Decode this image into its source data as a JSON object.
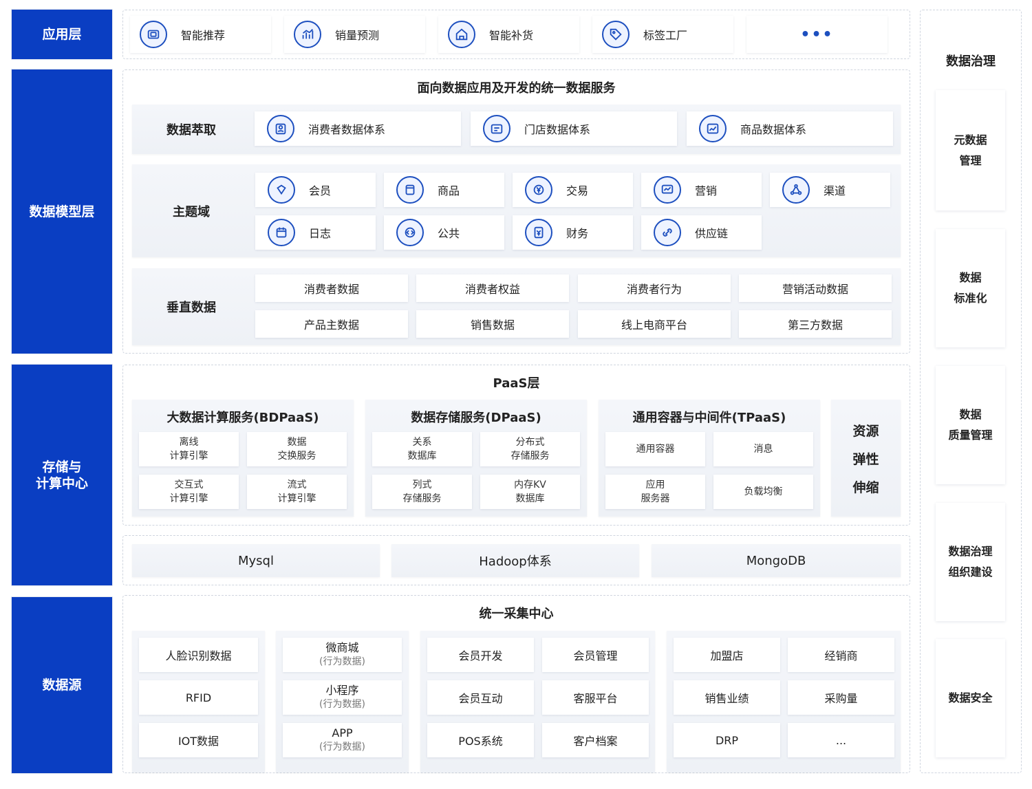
{
  "layers": {
    "app": "应用层",
    "model": "数据模型层",
    "storage": "存储与\n计算中心",
    "source": "数据源"
  },
  "app_layer": {
    "items": [
      {
        "label": "智能推荐",
        "icon": "recommend-icon"
      },
      {
        "label": "销量预测",
        "icon": "chart-icon"
      },
      {
        "label": "智能补货",
        "icon": "home-icon"
      },
      {
        "label": "标签工厂",
        "icon": "tag-icon"
      }
    ],
    "more": "•••"
  },
  "model_layer": {
    "title": "面向数据应用及开发的统一数据服务",
    "extract": {
      "label": "数据萃取",
      "items": [
        {
          "label": "消费者数据体系",
          "icon": "consumer-icon"
        },
        {
          "label": "门店数据体系",
          "icon": "store-icon"
        },
        {
          "label": "商品数据体系",
          "icon": "product-chart-icon"
        }
      ]
    },
    "subject": {
      "label": "主题域",
      "items": [
        {
          "label": "会员",
          "icon": "member-icon"
        },
        {
          "label": "商品",
          "icon": "goods-icon"
        },
        {
          "label": "交易",
          "icon": "yen-icon"
        },
        {
          "label": "营销",
          "icon": "marketing-icon"
        },
        {
          "label": "渠道",
          "icon": "channel-icon"
        },
        {
          "label": "日志",
          "icon": "log-icon"
        },
        {
          "label": "公共",
          "icon": "code-icon"
        },
        {
          "label": "财务",
          "icon": "finance-icon"
        },
        {
          "label": "供应链",
          "icon": "link-icon"
        }
      ]
    },
    "vertical": {
      "label": "垂直数据",
      "items": [
        "消费者数据",
        "消费者权益",
        "消费者行为",
        "营销活动数据",
        "产品主数据",
        "销售数据",
        "线上电商平台",
        "第三方数据"
      ]
    }
  },
  "paas_layer": {
    "title": "PaaS层",
    "groups": [
      {
        "title": "大数据计算服务(BDPaaS)",
        "items": [
          [
            "离线",
            "计算引擎"
          ],
          [
            "数据",
            "交换服务"
          ],
          [
            "交互式",
            "计算引擎"
          ],
          [
            "流式",
            "计算引擎"
          ]
        ]
      },
      {
        "title": "数据存储服务(DPaaS)",
        "items": [
          [
            "关系",
            "数据库"
          ],
          [
            "分布式",
            "存储服务"
          ],
          [
            "列式",
            "存储服务"
          ],
          [
            "内存KV",
            "数据库"
          ]
        ]
      },
      {
        "title": "通用容器与中间件(TPaaS)",
        "items": [
          [
            "通用容器"
          ],
          [
            "消息"
          ],
          [
            "应用",
            "服务器"
          ],
          [
            "负载均衡"
          ]
        ]
      }
    ],
    "elastic": [
      "资源",
      "弹性",
      "伸缩"
    ],
    "storage": [
      "Mysql",
      "Hadoop体系",
      "MongoDB"
    ]
  },
  "source_layer": {
    "title": "统一采集中心",
    "col1": [
      "人脸识别数据",
      "RFID",
      "IOT数据"
    ],
    "col2": [
      {
        "main": "微商城",
        "sub": "(行为数据)"
      },
      {
        "main": "小程序",
        "sub": "(行为数据)"
      },
      {
        "main": "APP",
        "sub": "(行为数据)"
      }
    ],
    "col3": [
      "会员开发",
      "会员管理",
      "会员互动",
      "客服平台",
      "POS系统",
      "客户档案"
    ],
    "col4": [
      "加盟店",
      "经销商",
      "销售业绩",
      "采购量",
      "DRP",
      "..."
    ]
  },
  "governance": {
    "title": "数据治理",
    "items": [
      "元数据\n管理",
      "数据\n标准化",
      "数据\n质量管理",
      "数据治理\n组织建设",
      "数据安全"
    ]
  },
  "colors": {
    "brand": "#0a3ec2",
    "icon_stroke": "#1d4fbf"
  }
}
